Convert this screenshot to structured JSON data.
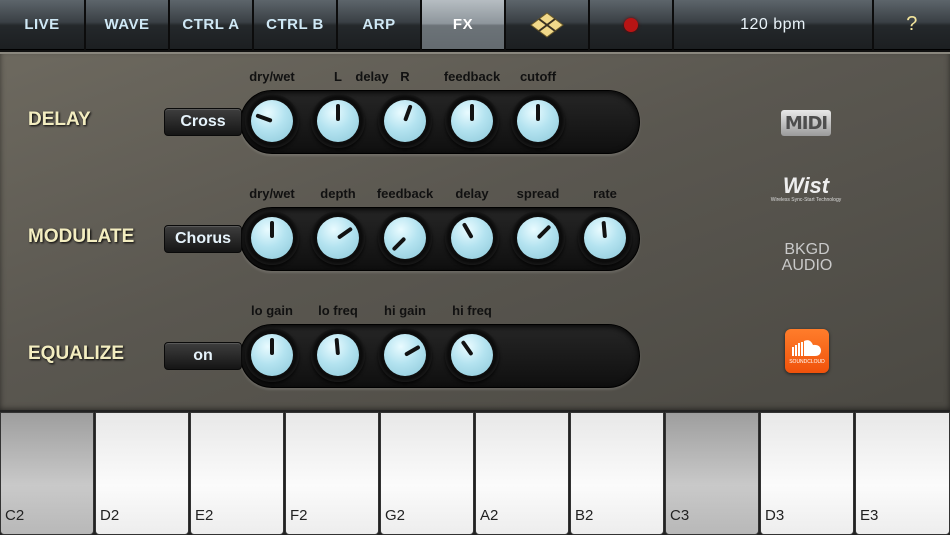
{
  "nav": {
    "tabs": [
      {
        "label": "LIVE"
      },
      {
        "label": "WAVE"
      },
      {
        "label": "CTRL A"
      },
      {
        "label": "CTRL B"
      },
      {
        "label": "ARP"
      },
      {
        "label": "FX"
      }
    ],
    "tempo": "120 bpm",
    "help": "?",
    "colors": {
      "record": "#b81414",
      "diamond": "#f1d98a",
      "accent_text": "#cfe8f5"
    }
  },
  "sections": [
    {
      "title": "DELAY",
      "mode": "Cross",
      "knobs": [
        {
          "label": "dry/wet",
          "value": -70
        },
        {
          "label": "L",
          "value": 0
        },
        {
          "label": "R",
          "value": 20
        },
        {
          "label": "feedback",
          "value": 0
        },
        {
          "label": "cutoff",
          "value": 0
        }
      ],
      "group_label": "delay"
    },
    {
      "title": "MODULATE",
      "mode": "Chorus",
      "knobs": [
        {
          "label": "dry/wet",
          "value": 0
        },
        {
          "label": "depth",
          "value": 55
        },
        {
          "label": "feedback",
          "value": -135
        },
        {
          "label": "delay",
          "value": -30
        },
        {
          "label": "spread",
          "value": 45
        },
        {
          "label": "rate",
          "value": -5
        }
      ]
    },
    {
      "title": "EQUALIZE",
      "mode": "on",
      "knobs": [
        {
          "label": "lo gain",
          "value": 0
        },
        {
          "label": "lo freq",
          "value": -5
        },
        {
          "label": "hi gain",
          "value": 60
        },
        {
          "label": "hi freq",
          "value": -35
        }
      ]
    }
  ],
  "logos": {
    "midi": "MIDI",
    "wist": "Wist",
    "wist_sub": "Wireless Sync-Start Technology",
    "bkgd": "BKGD AUDIO",
    "soundcloud": "SOUNDCLOUD"
  },
  "keys": [
    {
      "label": "C2",
      "pressed": true
    },
    {
      "label": "D2",
      "pressed": false
    },
    {
      "label": "E2",
      "pressed": false
    },
    {
      "label": "F2",
      "pressed": false
    },
    {
      "label": "G2",
      "pressed": false
    },
    {
      "label": "A2",
      "pressed": false
    },
    {
      "label": "B2",
      "pressed": false
    },
    {
      "label": "C3",
      "pressed": true
    },
    {
      "label": "D3",
      "pressed": false
    },
    {
      "label": "E3",
      "pressed": false
    }
  ]
}
